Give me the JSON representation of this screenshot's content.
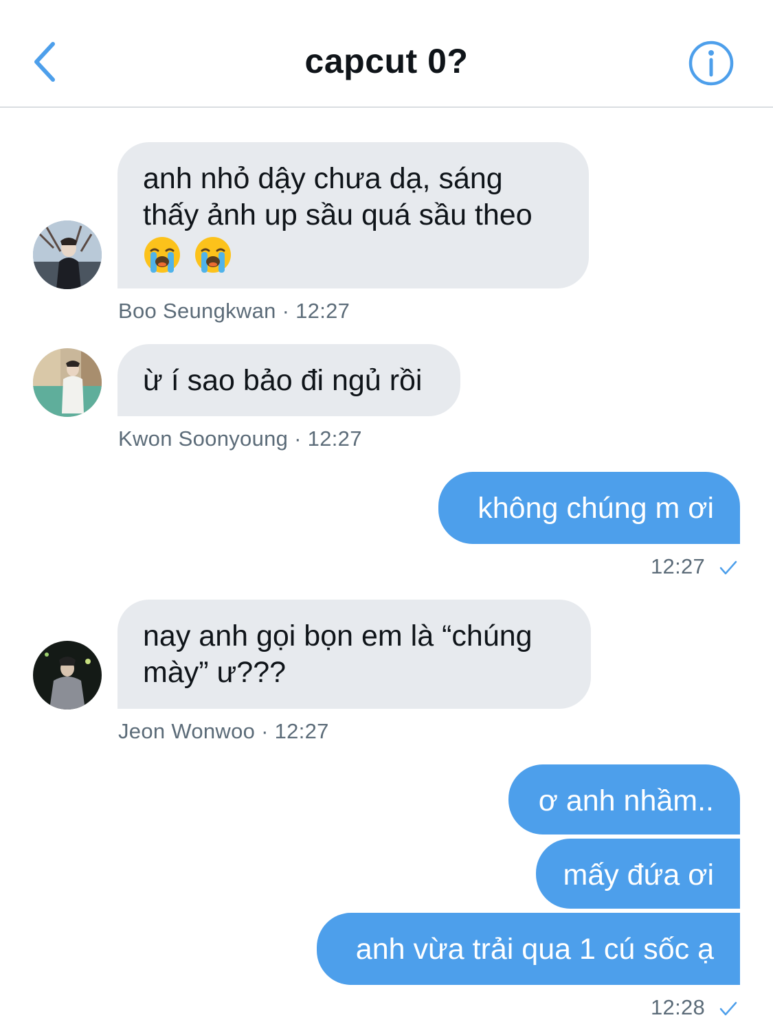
{
  "header": {
    "title": "capcut 0?",
    "back_icon": "chevron-left-icon",
    "info_icon": "info-icon",
    "accent": "#4d9feb"
  },
  "messages": [
    {
      "direction": "incoming",
      "lines": [
        "anh nhỏ dậy chưa dạ, sáng",
        "thấy ảnh up sầu quá sầu theo"
      ],
      "emoji": [
        "loudly-crying-face",
        "loudly-crying-face"
      ],
      "sender": "Boo Seungkwan",
      "time": "12:27",
      "meta": "Boo Seungkwan · 12:27"
    },
    {
      "direction": "incoming",
      "text": "ừ í sao bảo đi ngủ rồi",
      "sender": "Kwon Soonyoung",
      "time": "12:27",
      "meta": "Kwon Soonyoung · 12:27"
    },
    {
      "direction": "outgoing",
      "text": "không chúng m ơi",
      "time": "12:27"
    },
    {
      "direction": "incoming",
      "lines": [
        "nay anh gọi bọn em là “chúng",
        "mày” ư???"
      ],
      "sender": "Jeon Wonwoo",
      "time": "12:27",
      "meta": "Jeon Wonwoo · 12:27"
    },
    {
      "direction": "outgoing",
      "text": "ơ anh nhầm.."
    },
    {
      "direction": "outgoing",
      "text": "mấy đứa ơi"
    },
    {
      "direction": "outgoing",
      "text": "anh vừa trải qua 1 cú sốc ạ",
      "time": "12:28"
    }
  ],
  "colors": {
    "incoming_bubble": "#e7eaee",
    "outgoing_bubble": "#4d9feb",
    "meta_text": "#5b6b78"
  }
}
